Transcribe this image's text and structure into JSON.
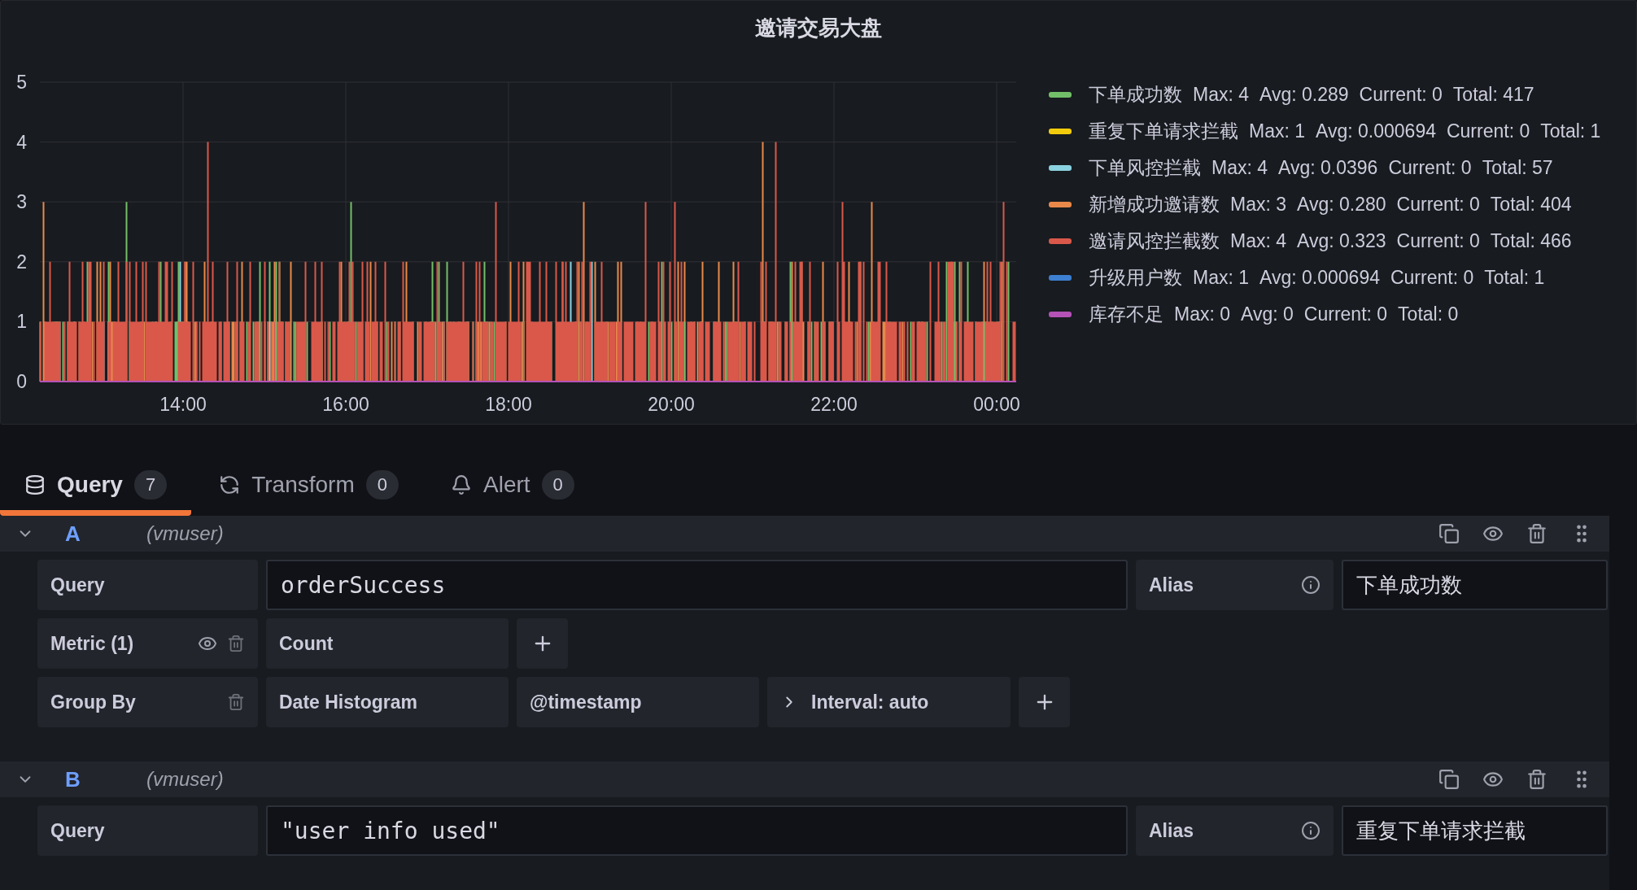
{
  "panel": {
    "title": "邀请交易大盘",
    "axis": {
      "y_labels": [
        "5",
        "4",
        "3",
        "2",
        "1",
        "0"
      ],
      "x_labels": [
        "14:00",
        "16:00",
        "18:00",
        "20:00",
        "22:00",
        "00:00"
      ]
    },
    "legend": [
      {
        "name": "下单成功数",
        "max": "Max: 4",
        "avg": "Avg: 0.289",
        "current": "Current: 0",
        "total": "Total: 417",
        "color": "#73bf69"
      },
      {
        "name": "重复下单请求拦截",
        "max": "Max: 1",
        "avg": "Avg: 0.000694",
        "current": "Current: 0",
        "total": "Total: 1",
        "color": "#f2cc0c"
      },
      {
        "name": "下单风控拦截",
        "max": "Max: 4",
        "avg": "Avg: 0.0396",
        "current": "Current: 0",
        "total": "Total: 57",
        "color": "#8ad2e0"
      },
      {
        "name": "新增成功邀请数",
        "max": "Max: 3",
        "avg": "Avg: 0.280",
        "current": "Current: 0",
        "total": "Total: 404",
        "color": "#e8894a"
      },
      {
        "name": "邀请风控拦截数",
        "max": "Max: 4",
        "avg": "Avg: 0.323",
        "current": "Current: 0",
        "total": "Total: 466",
        "color": "#d9584a"
      },
      {
        "name": "升级用户数",
        "max": "Max: 1",
        "avg": "Avg: 0.000694",
        "current": "Current: 0",
        "total": "Total: 1",
        "color": "#3d7fd1"
      },
      {
        "name": "库存不足",
        "max": "Max: 0",
        "avg": "Avg: 0",
        "current": "Current: 0",
        "total": "Total: 0",
        "color": "#b452b8"
      }
    ]
  },
  "tabs": [
    {
      "label": "Query",
      "count": "7",
      "selected": true
    },
    {
      "label": "Transform",
      "count": "0",
      "selected": false
    },
    {
      "label": "Alert",
      "count": "0",
      "selected": false
    }
  ],
  "queries": [
    {
      "letter": "A",
      "datasource": "(vmuser)",
      "expanded": true,
      "query_label": "Query",
      "query": "orderSuccess",
      "alias_label": "Alias",
      "alias": "下单成功数",
      "metric_label": "Metric (1)",
      "metric": "Count",
      "group_label": "Group By",
      "group_type": "Date Histogram",
      "group_field": "@timestamp",
      "interval": "Interval: auto"
    },
    {
      "letter": "B",
      "datasource": "(vmuser)",
      "expanded": true,
      "query_label": "Query",
      "query": "\"user info used\"",
      "alias_label": "Alias",
      "alias": "重复下单请求拦截"
    }
  ]
}
